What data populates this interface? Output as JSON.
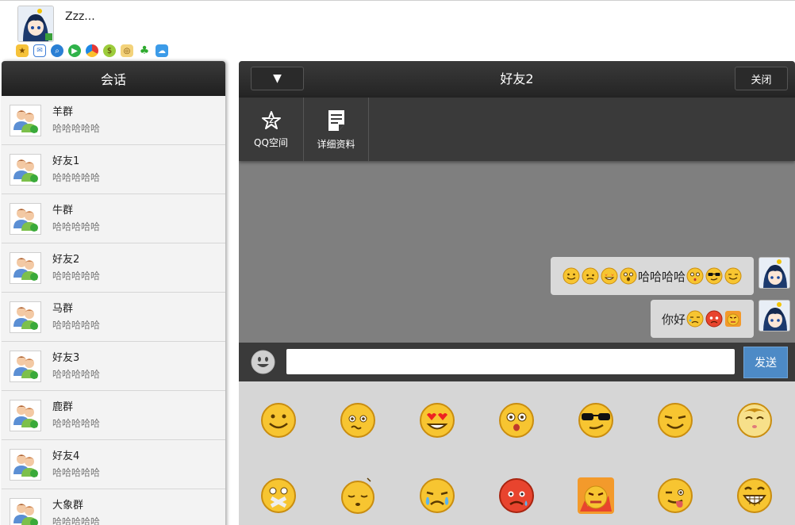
{
  "profile": {
    "nickname": "Zzz..."
  },
  "app_icons": [
    "qzone-star-icon",
    "mail-icon",
    "search-icon",
    "video-icon",
    "browser-icon",
    "money-bag-icon",
    "game-icon",
    "clover-icon",
    "cloud-icon"
  ],
  "sessions": {
    "title": "会话",
    "items": [
      {
        "name": "羊群",
        "msg": "哈哈哈哈哈"
      },
      {
        "name": "好友1",
        "msg": "哈哈哈哈哈"
      },
      {
        "name": "牛群",
        "msg": "哈哈哈哈哈"
      },
      {
        "name": "好友2",
        "msg": "哈哈哈哈哈"
      },
      {
        "name": "马群",
        "msg": "哈哈哈哈哈"
      },
      {
        "name": "好友3",
        "msg": "哈哈哈哈哈"
      },
      {
        "name": "鹿群",
        "msg": "哈哈哈哈哈"
      },
      {
        "name": "好友4",
        "msg": "哈哈哈哈哈"
      },
      {
        "name": "大象群",
        "msg": "哈哈哈哈哈"
      }
    ]
  },
  "chat": {
    "dropdown_symbol": "▼",
    "title": "好友2",
    "close_label": "关闭",
    "tools": [
      {
        "label": "QQ空间"
      },
      {
        "label": "详细资料"
      }
    ],
    "messages": [
      {
        "text": "哈哈哈哈"
      },
      {
        "text": "你好"
      }
    ],
    "input_value": "",
    "send_label": "发送"
  },
  "colors": {
    "send_button": "#4d8ac6",
    "header": "#2a2a2a",
    "chat_bg": "#7f7f7f",
    "emoji_bg": "#d6d6d6"
  }
}
